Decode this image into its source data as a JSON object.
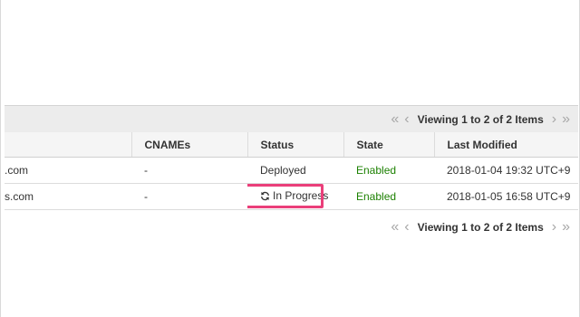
{
  "pager": {
    "first_icon": "«",
    "prev_icon": "‹",
    "info": "Viewing 1 to 2 of 2 Items",
    "next_icon": "›",
    "last_icon": "»"
  },
  "table": {
    "columns": [
      "",
      "CNAMEs",
      "Status",
      "State",
      "Last Modified"
    ],
    "rows": [
      {
        "name": ".com",
        "cnames": "-",
        "status": "Deployed",
        "state": "Enabled",
        "last_modified": "2018-01-04 19:32 UTC+9"
      },
      {
        "name": "s.com",
        "cnames": "-",
        "status": "In Progress",
        "state": "Enabled",
        "last_modified": "2018-01-05 16:58 UTC+9"
      }
    ]
  },
  "colors": {
    "state_enabled": "#1d8102",
    "highlight": "#ea3f7a"
  },
  "icons": {
    "status_in_progress": "refresh-icon"
  }
}
